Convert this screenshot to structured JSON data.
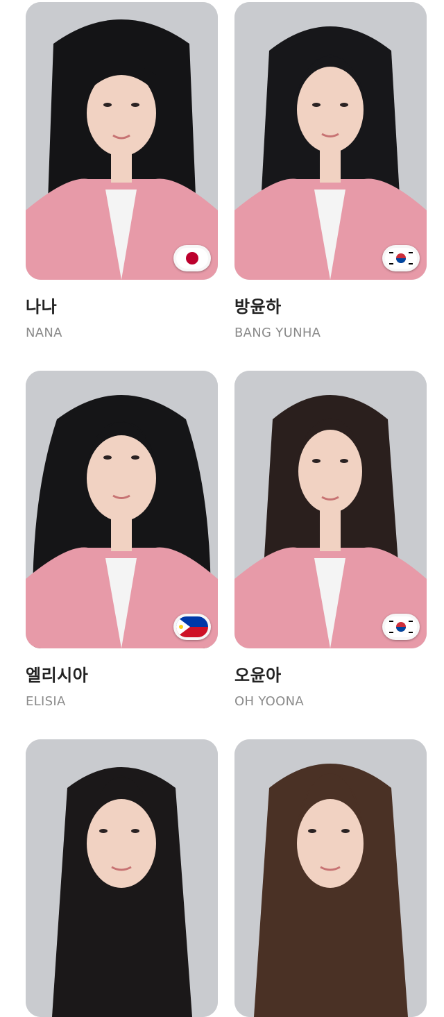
{
  "members": [
    {
      "name_ko": "나나",
      "name_en": "NANA",
      "flag": "japan-flag-icon",
      "hair": "#141416"
    },
    {
      "name_ko": "방윤하",
      "name_en": "BANG YUNHA",
      "flag": "korea-flag-icon",
      "hair": "#17171a"
    },
    {
      "name_ko": "엘리시아",
      "name_en": "ELISIA",
      "flag": "philippines-flag-icon",
      "hair": "#151517"
    },
    {
      "name_ko": "오윤아",
      "name_en": "OH YOONA",
      "flag": "korea-flag-icon",
      "hair": "#2a1f1d"
    },
    {
      "hair": "#1b1819"
    },
    {
      "hair": "#4a3125"
    }
  ],
  "colors": {
    "background": "#ffffff",
    "photo_bg": "#c9cbcf",
    "jacket_pink": "#e79aa8",
    "skin": "#f1d2c2",
    "name_ko": "#222222",
    "name_en": "#8a8a8a"
  }
}
